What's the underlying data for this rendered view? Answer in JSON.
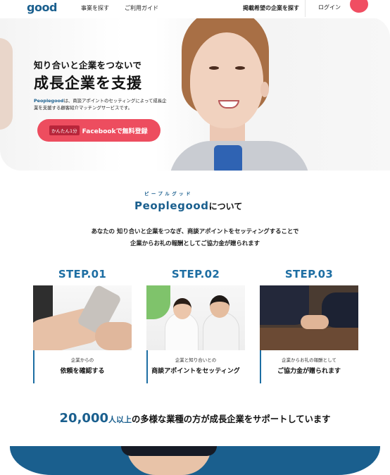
{
  "header": {
    "logo": "good",
    "nav": [
      "事業を探す",
      "ご利用ガイド"
    ],
    "cta_link": "掲載希望の企業を探す",
    "login": "ログイン"
  },
  "hero": {
    "subtitle": "知り合いと企業をつないで",
    "title": "成長企業を支援",
    "brand": "Peoplegood",
    "desc_rest": "は、商談アポイントのセッティングによって成長企業を支援する顧客紹介マッチングサービスです。",
    "cta_badge": "かんたん1分",
    "cta_label": "Facebookで無料登録"
  },
  "about": {
    "ruby": "ピープルグッド",
    "brand": "Peoplegood",
    "title_suffix": "について",
    "line1": "あなたの 知り合いと企業をつなぎ、商談アポイントをセッティングすることで",
    "line2": "企業からお礼の報酬としてご協力金が贈られます"
  },
  "steps": [
    {
      "label": "STEP.01",
      "small": "企業からの",
      "big": "依頼を確認する"
    },
    {
      "label": "STEP.02",
      "small": "企業と知り合いとの",
      "big": "商談アポイントをセッティング"
    },
    {
      "label": "STEP.03",
      "small": "企業からお礼の報酬として",
      "big": "ご協力金が贈られます"
    }
  ],
  "tagline": {
    "number": "20,000",
    "unit": "人以上",
    "rest": "の多様な業種の方が成長企業をサポートしています"
  },
  "colors": {
    "brand_blue": "#1a5f8e",
    "accent_red": "#ed4d5f"
  }
}
